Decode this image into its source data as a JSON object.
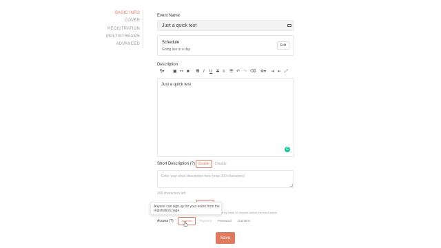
{
  "sidebar": {
    "items": [
      {
        "label": "BASIC INFO"
      },
      {
        "label": "COVER"
      },
      {
        "label": "REGISTRATION"
      },
      {
        "label": "MULTISTREAMS"
      },
      {
        "label": "ADVANCED"
      }
    ],
    "active_index": 0
  },
  "event_name": {
    "label": "Event Name",
    "value": "Just a quick test",
    "icon": "card-icon"
  },
  "schedule": {
    "title": "Schedule",
    "status": "Going live in a day",
    "edit_label": "Edit"
  },
  "description": {
    "label": "Description",
    "toolbar_icons": [
      "paragraph-icon",
      "image-icon",
      "link-icon",
      "video-icon",
      "bold-icon",
      "italic-icon",
      "underline-icon",
      "strikethrough-icon",
      "ordered-list-icon",
      "bullet-list-icon",
      "undo-icon",
      "redo-icon",
      "clear-format-icon",
      "align-icon",
      "indent-icon",
      "outdent-icon",
      "fullscreen-icon"
    ],
    "content": "Just a quick test",
    "grammarly_icon": "grammarly-icon"
  },
  "short_description": {
    "label": "Short Description (?)",
    "enable_label": "Enable",
    "disable_label": "Disable",
    "placeholder": "Enter your short description here (max 200 characters)",
    "chars_left": "200 characters left"
  },
  "reminder": {
    "text": "al by email 10 minutes before the event starts."
  },
  "tooltip": {
    "text": "Anyone can sign up for your event from the registration page."
  },
  "access": {
    "label": "Access (?)",
    "options": [
      "Anyone",
      "Payment",
      "Password",
      "Domains"
    ],
    "selected_index": 0
  },
  "save_label": "Save",
  "colors": {
    "accent": "#e07a5f",
    "grammarly": "#16c39a"
  }
}
